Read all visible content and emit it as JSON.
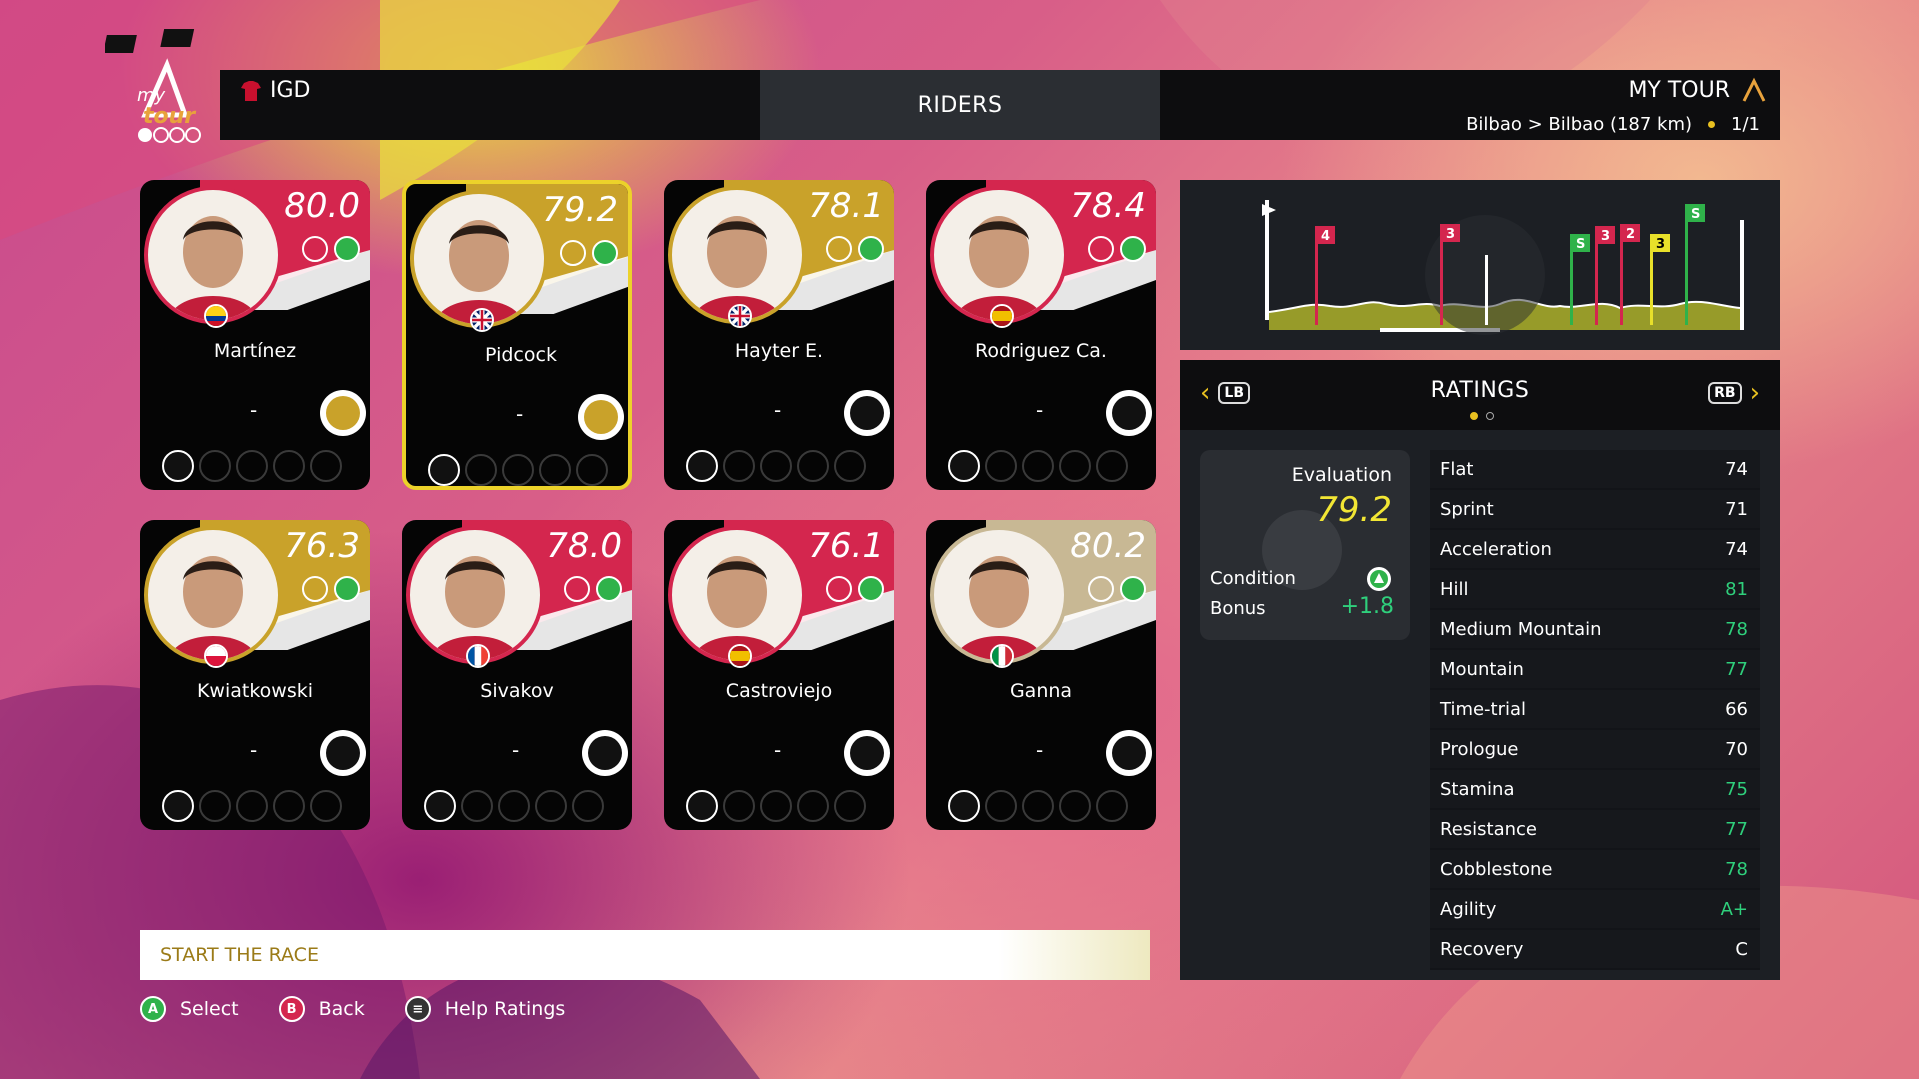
{
  "header": {
    "team": "IGD",
    "tab": "RIDERS",
    "mode_title": "MY TOUR",
    "route": "Bilbao > Bilbao (187 km)",
    "stage_counter": "1/1",
    "logo_text": "my tour"
  },
  "riders": [
    {
      "name": "Martínez",
      "rating": "80.0",
      "status": "-",
      "band_color": "#d4264e",
      "flag": "colombia",
      "selected": false,
      "badge": "gold"
    },
    {
      "name": "Pidcock",
      "rating": "79.2",
      "status": "-",
      "band_color": "#c9a22a",
      "flag": "uk",
      "selected": true,
      "badge": "gold"
    },
    {
      "name": "Hayter E.",
      "rating": "78.1",
      "status": "-",
      "band_color": "#c9a22a",
      "flag": "uk",
      "selected": false,
      "badge": "white"
    },
    {
      "name": "Rodriguez Ca.",
      "rating": "78.4",
      "status": "-",
      "band_color": "#d4264e",
      "flag": "spain",
      "selected": false,
      "badge": "white"
    },
    {
      "name": "Kwiatkowski",
      "rating": "76.3",
      "status": "-",
      "band_color": "#c9a22a",
      "flag": "poland",
      "selected": false,
      "badge": "white"
    },
    {
      "name": "Sivakov",
      "rating": "78.0",
      "status": "-",
      "band_color": "#d4264e",
      "flag": "france",
      "selected": false,
      "badge": "white"
    },
    {
      "name": "Castroviejo",
      "rating": "76.1",
      "status": "-",
      "band_color": "#d4264e",
      "flag": "spain",
      "selected": false,
      "badge": "white"
    },
    {
      "name": "Ganna",
      "rating": "80.2",
      "status": "-",
      "band_color": "#c8b894",
      "flag": "italy",
      "selected": false,
      "badge": "white"
    }
  ],
  "start_race": "START THE RACE",
  "prompts": [
    {
      "key": "A",
      "label": "Select",
      "color": "#2fb24a"
    },
    {
      "key": "B",
      "label": "Back",
      "color": "#d4264e"
    },
    {
      "key": "≡",
      "label": "Help Ratings",
      "color": "#333333"
    }
  ],
  "ratings_panel": {
    "title": "RATINGS",
    "lb": "LB",
    "rb": "RB",
    "evaluation_label": "Evaluation",
    "evaluation_value": "79.2",
    "condition_label": "Condition",
    "bonus_label": "Bonus",
    "bonus_value": "+1.8",
    "stats": [
      {
        "label": "Flat",
        "value": "74",
        "hi": false
      },
      {
        "label": "Sprint",
        "value": "71",
        "hi": false
      },
      {
        "label": "Acceleration",
        "value": "74",
        "hi": false
      },
      {
        "label": "Hill",
        "value": "81",
        "hi": true
      },
      {
        "label": "Medium Mountain",
        "value": "78",
        "hi": true
      },
      {
        "label": "Mountain",
        "value": "77",
        "hi": true
      },
      {
        "label": "Time-trial",
        "value": "66",
        "hi": false
      },
      {
        "label": "Prologue",
        "value": "70",
        "hi": false
      },
      {
        "label": "Stamina",
        "value": "75",
        "hi": true
      },
      {
        "label": "Resistance",
        "value": "77",
        "hi": true
      },
      {
        "label": "Cobblestone",
        "value": "78",
        "hi": true
      },
      {
        "label": "Agility",
        "value": "A+",
        "hi": true
      },
      {
        "label": "Recovery",
        "value": "C",
        "hi": false
      }
    ]
  },
  "profile_markers": [
    "4",
    "3",
    "S",
    "3",
    "2",
    "3",
    "S"
  ],
  "colors": {
    "accent": "#e8c020",
    "positive": "#2fd07c",
    "panel": "#1c1f24"
  }
}
